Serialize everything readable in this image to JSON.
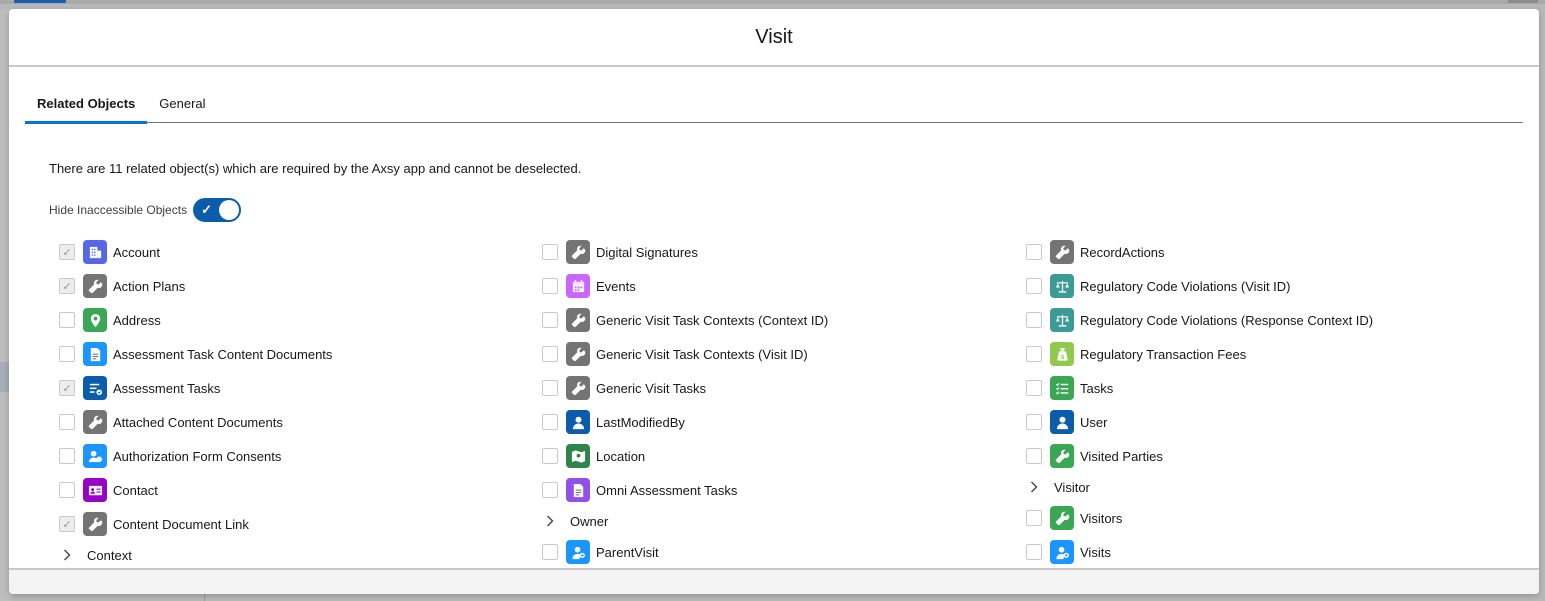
{
  "modal": {
    "title": "Visit",
    "tabs": [
      {
        "label": "Related Objects",
        "active": true
      },
      {
        "label": "General",
        "active": false
      }
    ],
    "info_text": "There are 11 related object(s) which are required by the Axsy app and cannot be deselected.",
    "toggle": {
      "label": "Hide Inaccessible Objects",
      "on": true
    }
  },
  "colors": {
    "wrench": "#747474",
    "account": "#5867e8",
    "address": "#3ba755",
    "assessment_doc": "#1b96ff",
    "assessment_tasks": "#0b5cab",
    "auth_consent": "#1b96ff",
    "contact": "#9602c7",
    "events": "#cb65ff",
    "user": "#0b5cab",
    "location": "#2e844a",
    "omni": "#9050e9",
    "parent_visit": "#1b96ff",
    "reg_violation": "#3c9b94",
    "reg_fee": "#91c94c",
    "tasks": "#3ba755",
    "visited_parties": "#3ba755",
    "visits": "#1b96ff"
  },
  "columns": [
    [
      {
        "type": "item",
        "label": "Account",
        "checked": true,
        "icon": "account-icon",
        "color": "#5867e8"
      },
      {
        "type": "item",
        "label": "Action Plans",
        "checked": true,
        "icon": "wrench-icon",
        "color": "#747474"
      },
      {
        "type": "item",
        "label": "Address",
        "checked": false,
        "icon": "location-pin-icon",
        "color": "#3ba755"
      },
      {
        "type": "item",
        "label": "Assessment Task Content Documents",
        "checked": false,
        "icon": "document-icon",
        "color": "#1b96ff"
      },
      {
        "type": "item",
        "label": "Assessment Tasks",
        "checked": true,
        "icon": "checklist-icon",
        "color": "#0b5cab"
      },
      {
        "type": "item",
        "label": "Attached Content Documents",
        "checked": false,
        "icon": "wrench-icon",
        "color": "#747474"
      },
      {
        "type": "item",
        "label": "Authorization Form Consents",
        "checked": false,
        "icon": "consent-icon",
        "color": "#1b96ff"
      },
      {
        "type": "item",
        "label": "Contact",
        "checked": false,
        "icon": "contact-card-icon",
        "color": "#9602c7"
      },
      {
        "type": "item",
        "label": "Content Document Link",
        "checked": true,
        "icon": "wrench-icon",
        "color": "#747474"
      },
      {
        "type": "expand",
        "label": "Context"
      }
    ],
    [
      {
        "type": "item",
        "label": "Digital Signatures",
        "checked": false,
        "icon": "wrench-icon",
        "color": "#747474"
      },
      {
        "type": "item",
        "label": "Events",
        "checked": false,
        "icon": "calendar-icon",
        "color": "#cb65ff"
      },
      {
        "type": "item",
        "label": "Generic Visit Task Contexts (Context ID)",
        "checked": false,
        "icon": "wrench-icon",
        "color": "#747474"
      },
      {
        "type": "item",
        "label": "Generic Visit Task Contexts (Visit ID)",
        "checked": false,
        "icon": "wrench-icon",
        "color": "#747474"
      },
      {
        "type": "item",
        "label": "Generic Visit Tasks",
        "checked": false,
        "icon": "wrench-icon",
        "color": "#747474"
      },
      {
        "type": "item",
        "label": "LastModifiedBy",
        "checked": false,
        "icon": "user-icon",
        "color": "#0b5cab"
      },
      {
        "type": "item",
        "label": "Location",
        "checked": false,
        "icon": "map-icon",
        "color": "#2e844a"
      },
      {
        "type": "item",
        "label": "Omni Assessment Tasks",
        "checked": false,
        "icon": "document-icon",
        "color": "#9050e9"
      },
      {
        "type": "expand",
        "label": "Owner"
      },
      {
        "type": "item",
        "label": "ParentVisit",
        "checked": false,
        "icon": "visit-icon",
        "color": "#1b96ff"
      }
    ],
    [
      {
        "type": "item",
        "label": "RecordActions",
        "checked": false,
        "icon": "wrench-icon",
        "color": "#747474"
      },
      {
        "type": "item",
        "label": "Regulatory Code Violations (Visit ID)",
        "checked": false,
        "icon": "scales-icon",
        "color": "#3c9b94"
      },
      {
        "type": "item",
        "label": "Regulatory Code Violations (Response Context ID)",
        "checked": false,
        "icon": "scales-icon",
        "color": "#3c9b94"
      },
      {
        "type": "item",
        "label": "Regulatory Transaction Fees",
        "checked": false,
        "icon": "money-bag-icon",
        "color": "#91c94c"
      },
      {
        "type": "item",
        "label": "Tasks",
        "checked": false,
        "icon": "task-list-icon",
        "color": "#3ba755"
      },
      {
        "type": "item",
        "label": "User",
        "checked": false,
        "icon": "user-icon",
        "color": "#0b5cab"
      },
      {
        "type": "item",
        "label": "Visited Parties",
        "checked": false,
        "icon": "wrench-icon",
        "color": "#3ba755"
      },
      {
        "type": "expand",
        "label": "Visitor"
      },
      {
        "type": "item",
        "label": "Visitors",
        "checked": false,
        "icon": "wrench-icon",
        "color": "#3ba755"
      },
      {
        "type": "item",
        "label": "Visits",
        "checked": false,
        "icon": "visit-icon",
        "color": "#1b96ff"
      }
    ]
  ]
}
